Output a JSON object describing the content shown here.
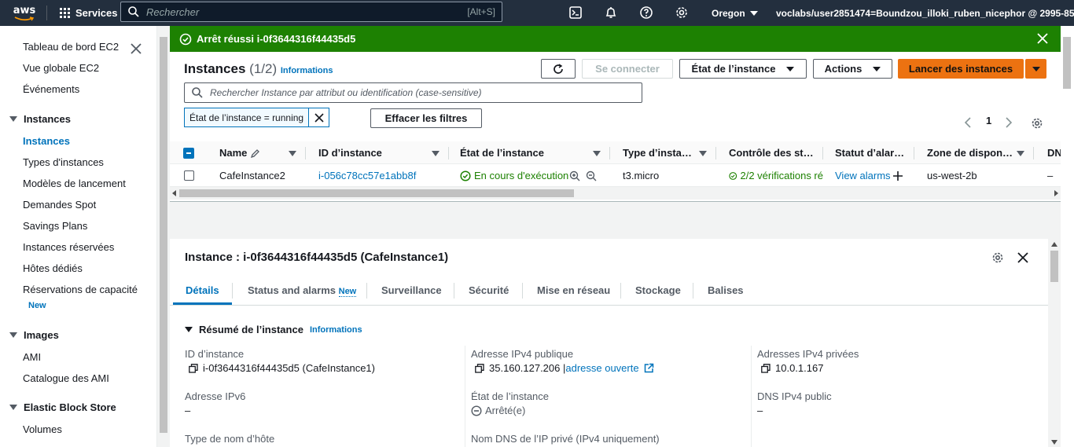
{
  "topnav": {
    "logo": "aws",
    "services": "Services",
    "search_placeholder": "Rechercher",
    "search_shortcut": "[Alt+S]",
    "region": "Oregon",
    "account": "voclabs/user2851474=Boundzou_illoki_ruben_nicephor @ 2995-855..."
  },
  "sidebar": {
    "items_top": [
      "Tableau de bord EC2",
      "Vue globale EC2",
      "Événements"
    ],
    "section_instances": "Instances",
    "instances_items": [
      "Instances",
      "Types d'instances",
      "Modèles de lancement",
      "Demandes Spot",
      "Savings Plans",
      "Instances réservées",
      "Hôtes dédiés",
      "Réservations de capacité"
    ],
    "new_badge": "New",
    "section_images": "Images",
    "images_items": [
      "AMI",
      "Catalogue des AMI"
    ],
    "section_ebs": "Elastic Block Store",
    "ebs_items": [
      "Volumes"
    ]
  },
  "flash": {
    "message": "Arrêt réussi i-0f3644316f44435d5"
  },
  "instances": {
    "title": "Instances",
    "count": "(1/2)",
    "info": "Informations",
    "connect_label": "Se connecter",
    "state_label": "État de l’instance",
    "actions_label": "Actions",
    "launch_label": "Lancer des instances",
    "filter_placeholder": "Rechercher Instance par attribut ou identification (case-sensitive)",
    "token": "État de l’instance = running",
    "clear_filters": "Effacer les filtres",
    "page": "1",
    "columns": [
      "Name",
      "ID d’instance",
      "État de l’instance",
      "Type d’insta…",
      "Contrôle des st…",
      "Statut d’alar…",
      "Zone de dispon…",
      "DN"
    ],
    "row": {
      "name": "CafeInstance2",
      "id": "i-056c78cc57e1abb8f",
      "state": "En cours d'exécution",
      "type": "t3.micro",
      "checks": "2/2 vérifications ré",
      "alarms": "View alarms",
      "zone": "us-west-2b",
      "dns": "–"
    }
  },
  "detail": {
    "title": "Instance : i-0f3644316f44435d5 (CafeInstance1)",
    "tabs": [
      "Détails",
      "Status and alarms",
      "Surveillance",
      "Sécurité",
      "Mise en réseau",
      "Stockage",
      "Balises"
    ],
    "tab_new": "New",
    "summary": "Résumé de l’instance",
    "summary_info": "Informations",
    "fields": {
      "id_label": "ID d’instance",
      "id_value": "i-0f3644316f44435d5 (CafeInstance1)",
      "ipv4_pub_label": "Adresse IPv4 publique",
      "ipv4_pub_value": "35.160.127.206 |",
      "ipv4_pub_link": "adresse ouverte",
      "ipv4_priv_label": "Adresses IPv4 privées",
      "ipv4_priv_value": "10.0.1.167",
      "ipv6_label": "Adresse IPv6",
      "ipv6_value": "–",
      "state_label": "État de l’instance",
      "state_value": "Arrêté(e)",
      "dns_pub_label": "DNS IPv4 public",
      "dns_pub_value": "–",
      "hostname_label": "Type de nom d’hôte",
      "dns_priv_label": "Nom DNS de l’IP privé (IPv4 uniquement)"
    }
  }
}
